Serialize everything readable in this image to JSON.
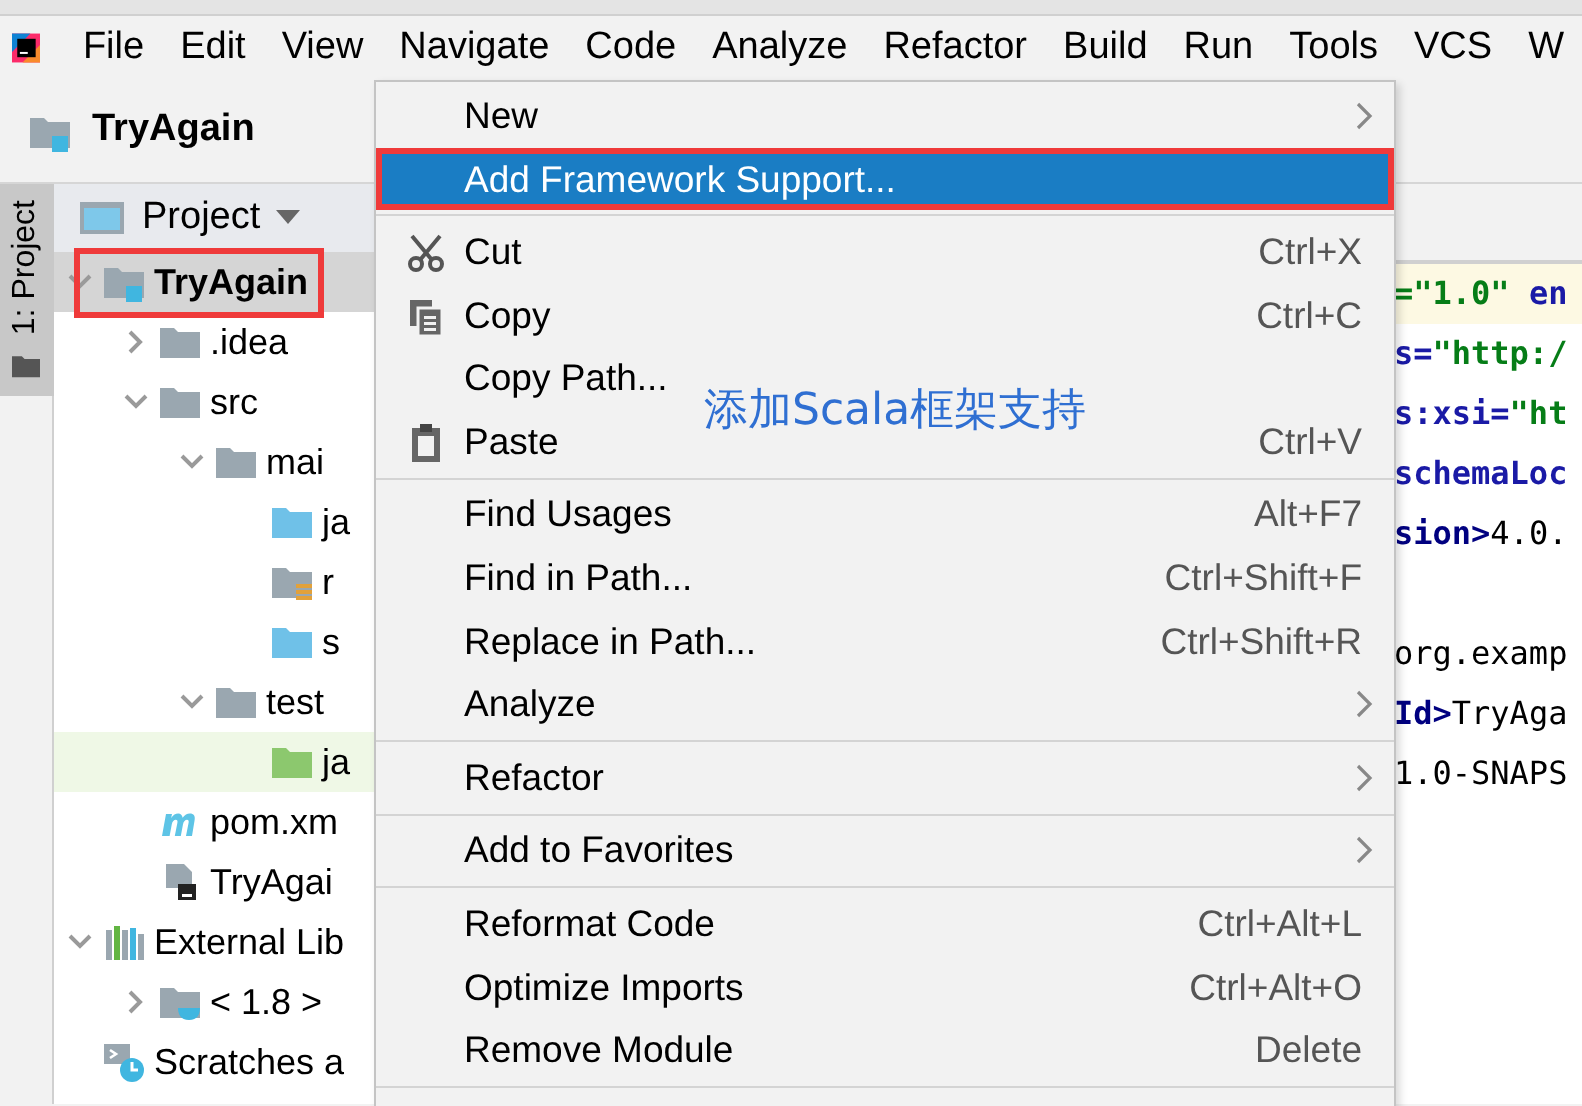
{
  "menu_bar": [
    "File",
    "Edit",
    "View",
    "Navigate",
    "Code",
    "Analyze",
    "Refactor",
    "Build",
    "Run",
    "Tools",
    "VCS",
    "W"
  ],
  "project_title": "TryAgain",
  "tool_strip": {
    "label": "1: Project"
  },
  "project_pane": {
    "header": "Project",
    "tree": [
      {
        "label": "TryAgain",
        "kind": "module",
        "expanded": true,
        "selected": true,
        "annotated": true,
        "children": [
          {
            "label": ".idea",
            "kind": "folder",
            "expanded": false
          },
          {
            "label": "src",
            "kind": "folder",
            "expanded": true,
            "children": [
              {
                "label": "mai",
                "kind": "folder",
                "expanded": true,
                "children": [
                  {
                    "label": "ja",
                    "kind": "source"
                  },
                  {
                    "label": "r",
                    "kind": "resources"
                  },
                  {
                    "label": "s",
                    "kind": "source"
                  }
                ]
              },
              {
                "label": "test",
                "kind": "folder",
                "expanded": true,
                "children": [
                  {
                    "label": "ja",
                    "kind": "test-source",
                    "current": true
                  }
                ]
              }
            ]
          },
          {
            "label": "pom.xm",
            "kind": "maven"
          },
          {
            "label": "TryAgai",
            "kind": "file"
          }
        ]
      },
      {
        "label": "External Lib",
        "kind": "libraries",
        "expanded": true,
        "children": [
          {
            "label": "< 1.8 >",
            "kind": "jdk",
            "expanded": false
          }
        ]
      },
      {
        "label": "Scratches a",
        "kind": "scratches"
      }
    ]
  },
  "editor_blocks": [
    [
      {
        "parts": [
          {
            "text": "=\"1.0\" ",
            "kind": "string"
          },
          {
            "text": "en",
            "kind": "attr"
          }
        ],
        "current": true
      },
      {
        "parts": [
          {
            "text": "s=",
            "kind": "attr"
          },
          {
            "text": "\"http:/",
            "kind": "string"
          }
        ]
      },
      {
        "parts": [
          {
            "text": "s:xsi=",
            "kind": "attr"
          },
          {
            "text": "\"ht",
            "kind": "string"
          }
        ]
      },
      {
        "parts": [
          {
            "text": "schemaLoc",
            "kind": "attr"
          }
        ]
      },
      {
        "parts": [
          {
            "text": "sion>",
            "kind": "tag"
          },
          {
            "text": "4.0.",
            "kind": "plain"
          }
        ]
      }
    ],
    [
      {
        "parts": [
          {
            "text": "org.examp",
            "kind": "plain"
          }
        ]
      },
      {
        "parts": [
          {
            "text": "Id>",
            "kind": "tag"
          },
          {
            "text": "TryAga",
            "kind": "plain"
          }
        ]
      },
      {
        "parts": [
          {
            "text": "1.0-SNAPS",
            "kind": "plain"
          }
        ]
      }
    ]
  ],
  "context_menu": {
    "annotation": "添加Scala框架支持",
    "groups": [
      [
        {
          "label": "New",
          "submenu": true,
          "selected": false
        },
        {
          "label": "Add Framework Support...",
          "selected": true,
          "annotated": true
        }
      ],
      [
        {
          "label": "Cut",
          "kind": "cut",
          "shortcut": "Ctrl+X",
          "selected": false
        },
        {
          "label": "Copy",
          "kind": "copy",
          "shortcut": "Ctrl+C",
          "selected": false
        },
        {
          "label": "Copy Path...",
          "selected": false
        },
        {
          "label": "Paste",
          "kind": "paste",
          "shortcut": "Ctrl+V",
          "selected": false
        }
      ],
      [
        {
          "label": "Find Usages",
          "shortcut": "Alt+F7",
          "selected": false
        },
        {
          "label": "Find in Path...",
          "shortcut": "Ctrl+Shift+F",
          "selected": false
        },
        {
          "label": "Replace in Path...",
          "shortcut": "Ctrl+Shift+R",
          "selected": false
        },
        {
          "label": "Analyze",
          "submenu": true,
          "selected": false
        }
      ],
      [
        {
          "label": "Refactor",
          "submenu": true,
          "selected": false
        }
      ],
      [
        {
          "label": "Add to Favorites",
          "submenu": true,
          "selected": false
        }
      ],
      [
        {
          "label": "Reformat Code",
          "shortcut": "Ctrl+Alt+L",
          "selected": false
        },
        {
          "label": "Optimize Imports",
          "shortcut": "Ctrl+Alt+O",
          "selected": false
        },
        {
          "label": "Remove Module",
          "shortcut": "Delete",
          "selected": false
        }
      ]
    ]
  }
}
